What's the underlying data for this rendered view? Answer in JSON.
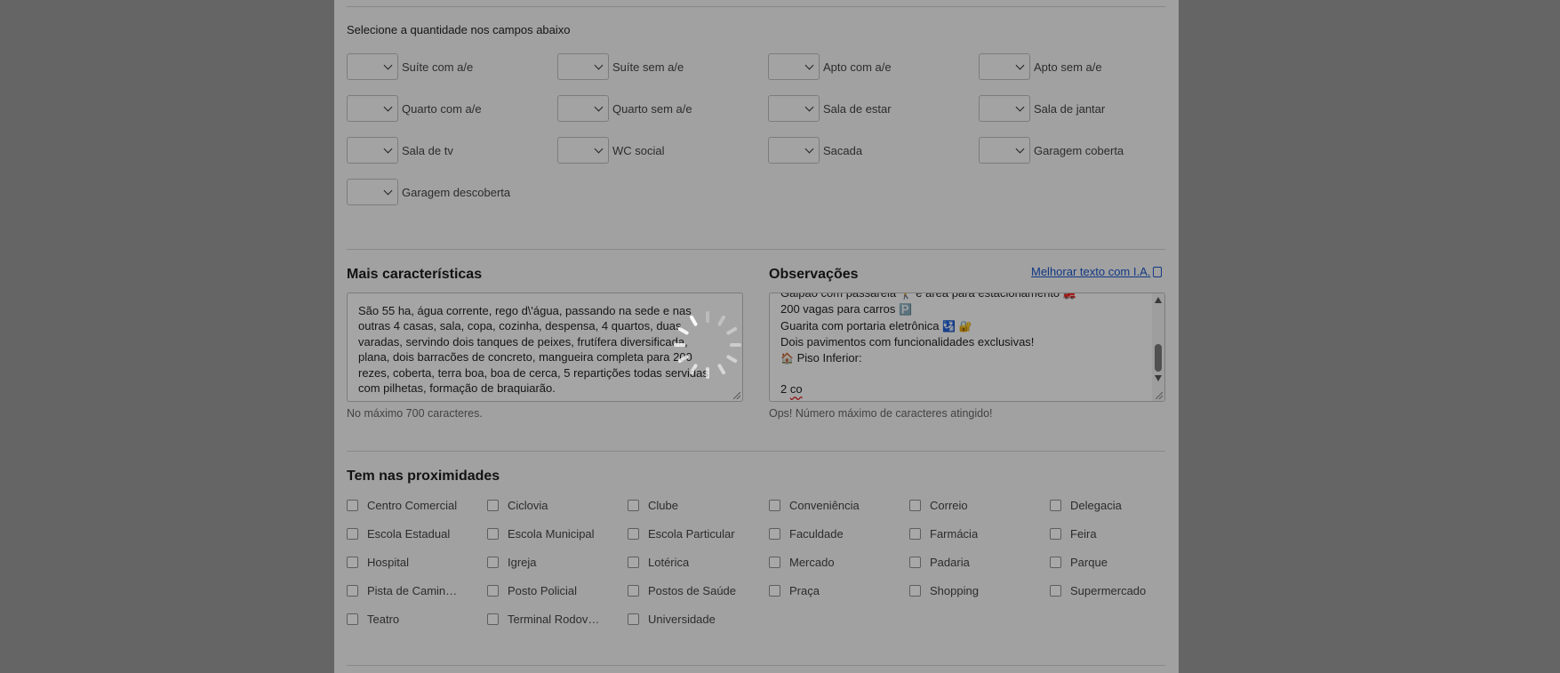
{
  "quantity": {
    "instruction": "Selecione a quantidade nos campos abaixo",
    "rows": [
      [
        {
          "label": "Suíte com a/e",
          "value": ""
        },
        {
          "label": "Suíte sem a/e",
          "value": ""
        },
        {
          "label": "Apto com a/e",
          "value": ""
        },
        {
          "label": "Apto sem a/e",
          "value": ""
        }
      ],
      [
        {
          "label": "Quarto com a/e",
          "value": ""
        },
        {
          "label": "Quarto sem a/e",
          "value": ""
        },
        {
          "label": "Sala de estar",
          "value": ""
        },
        {
          "label": "Sala de jantar",
          "value": ""
        }
      ],
      [
        {
          "label": "Sala de tv",
          "value": ""
        },
        {
          "label": "WC social",
          "value": ""
        },
        {
          "label": "Sacada",
          "value": ""
        },
        {
          "label": "Garagem coberta",
          "value": ""
        }
      ],
      [
        {
          "label": "Garagem descoberta",
          "value": ""
        }
      ]
    ]
  },
  "features": {
    "title": "Mais características",
    "lines": [
      "São 55 ha, água corrente, rego d\\'água, passando na sede e nas",
      "outras 4 casas, sala, copa, cozinha, despensa, 4 quartos, duas",
      "varadas, servindo dois tanques de peixes, frutífera diversificada,",
      "plana, dois barracões de concreto, mangueira completa para 200",
      "rezes, coberta, terra boa, boa de cerca, 5 repartições todas servidas",
      "com pilhetas, formação de braquiarão."
    ],
    "hint": "No máximo 700 caracteres."
  },
  "notes": {
    "title": "Observações",
    "ai_link": "Melhorar texto com I.A.",
    "lines": [
      {
        "text": "Galpão com passarela",
        "emoji": "🚶",
        "text2": "e área para estacionamento",
        "emoji2": "🚒"
      },
      {
        "text": "200 vagas para carros",
        "emoji": "🅿️",
        "text2": "",
        "emoji2": ""
      },
      {
        "text": "Guarita com portaria eletrônica",
        "emoji": "🛂",
        "text2": "",
        "emoji2": "🔐"
      },
      {
        "text": "Dois pavimentos com funcionalidades exclusivas!",
        "emoji": "",
        "text2": "",
        "emoji2": ""
      },
      {
        "text": "Piso Inferior:",
        "emoji": "🏠",
        "text2": "",
        "emoji2": ""
      }
    ],
    "last_line_prefix": "2 ",
    "last_line_misspelled": "co",
    "hint": "Ops! Número máximo de caracteres atingido!"
  },
  "nearby": {
    "title": "Tem nas proximidades",
    "items": [
      "Centro Comercial",
      "Ciclovia",
      "Clube",
      "Conveniência",
      "Correio",
      "Delegacia",
      "Escola Estadual",
      "Escola Municipal",
      "Escola Particular",
      "Faculdade",
      "Farmácia",
      "Feira",
      "Hospital",
      "Igreja",
      "Lotérica",
      "Mercado",
      "Padaria",
      "Parque",
      "Pista de Caminhada",
      "Posto Policial",
      "Postos de Saúde",
      "Praça",
      "Shopping",
      "Supermercado",
      "Teatro",
      "Terminal Rodoviário",
      "Universidade"
    ]
  },
  "loading": {
    "active": true
  }
}
